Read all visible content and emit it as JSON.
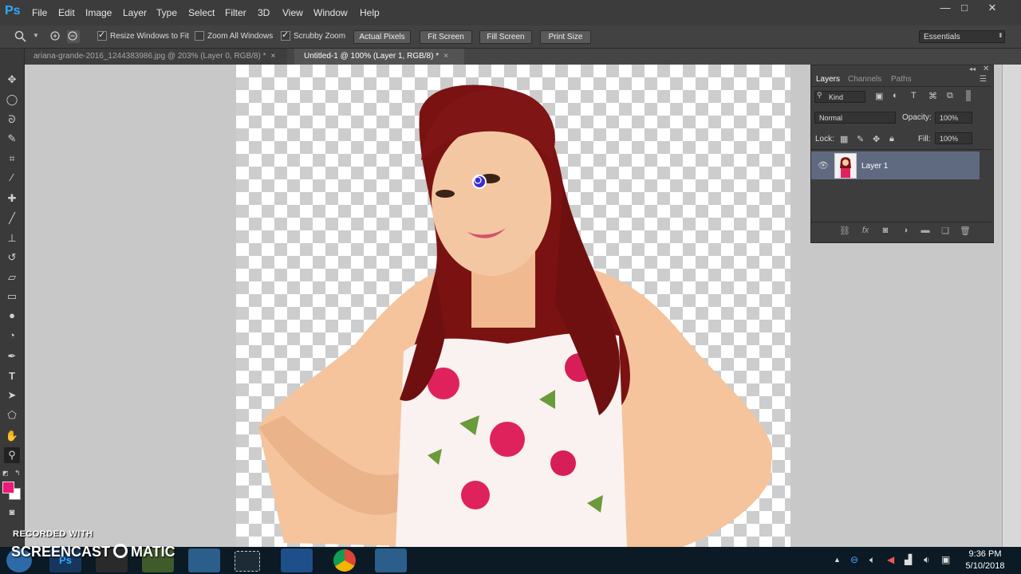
{
  "app": {
    "logo": "Ps"
  },
  "menu": [
    "File",
    "Edit",
    "Image",
    "Layer",
    "Type",
    "Select",
    "Filter",
    "3D",
    "View",
    "Window",
    "Help"
  ],
  "window_controls": {
    "minimize": "—",
    "maximize": "□",
    "close": "✕"
  },
  "options_bar": {
    "resize_windows": "Resize Windows to Fit",
    "zoom_all": "Zoom All Windows",
    "scrubby_zoom": "Scrubby Zoom",
    "actual_pixels": "Actual Pixels",
    "fit_screen": "Fit Screen",
    "fill_screen": "Fill Screen",
    "print_size": "Print Size",
    "workspace": "Essentials"
  },
  "tabs": [
    {
      "label": "ariana-grande-2016_1244383986.jpg @ 203% (Layer 0, RGB/8) *",
      "close": "×"
    },
    {
      "label": "Untitled-1 @ 100% (Layer 1, RGB/8) *",
      "close": "×"
    }
  ],
  "colors": {
    "foreground": "#ef1777",
    "background": "#ffffff",
    "selection": "#5f6a80"
  },
  "layers_panel": {
    "tabs": [
      "Layers",
      "Channels",
      "Paths"
    ],
    "kind": "Kind",
    "blend_mode": "Normal",
    "opacity_label": "Opacity:",
    "opacity_value": "100%",
    "lock_label": "Lock:",
    "fill_label": "Fill:",
    "fill_value": "100%",
    "layer_name": "Layer 1"
  },
  "taskbar": {
    "time": "9:36 PM",
    "date": "5/10/2018"
  },
  "watermark": {
    "line1": "RECORDED WITH",
    "line2": "SCREENCAST",
    "line3": "MATIC"
  }
}
